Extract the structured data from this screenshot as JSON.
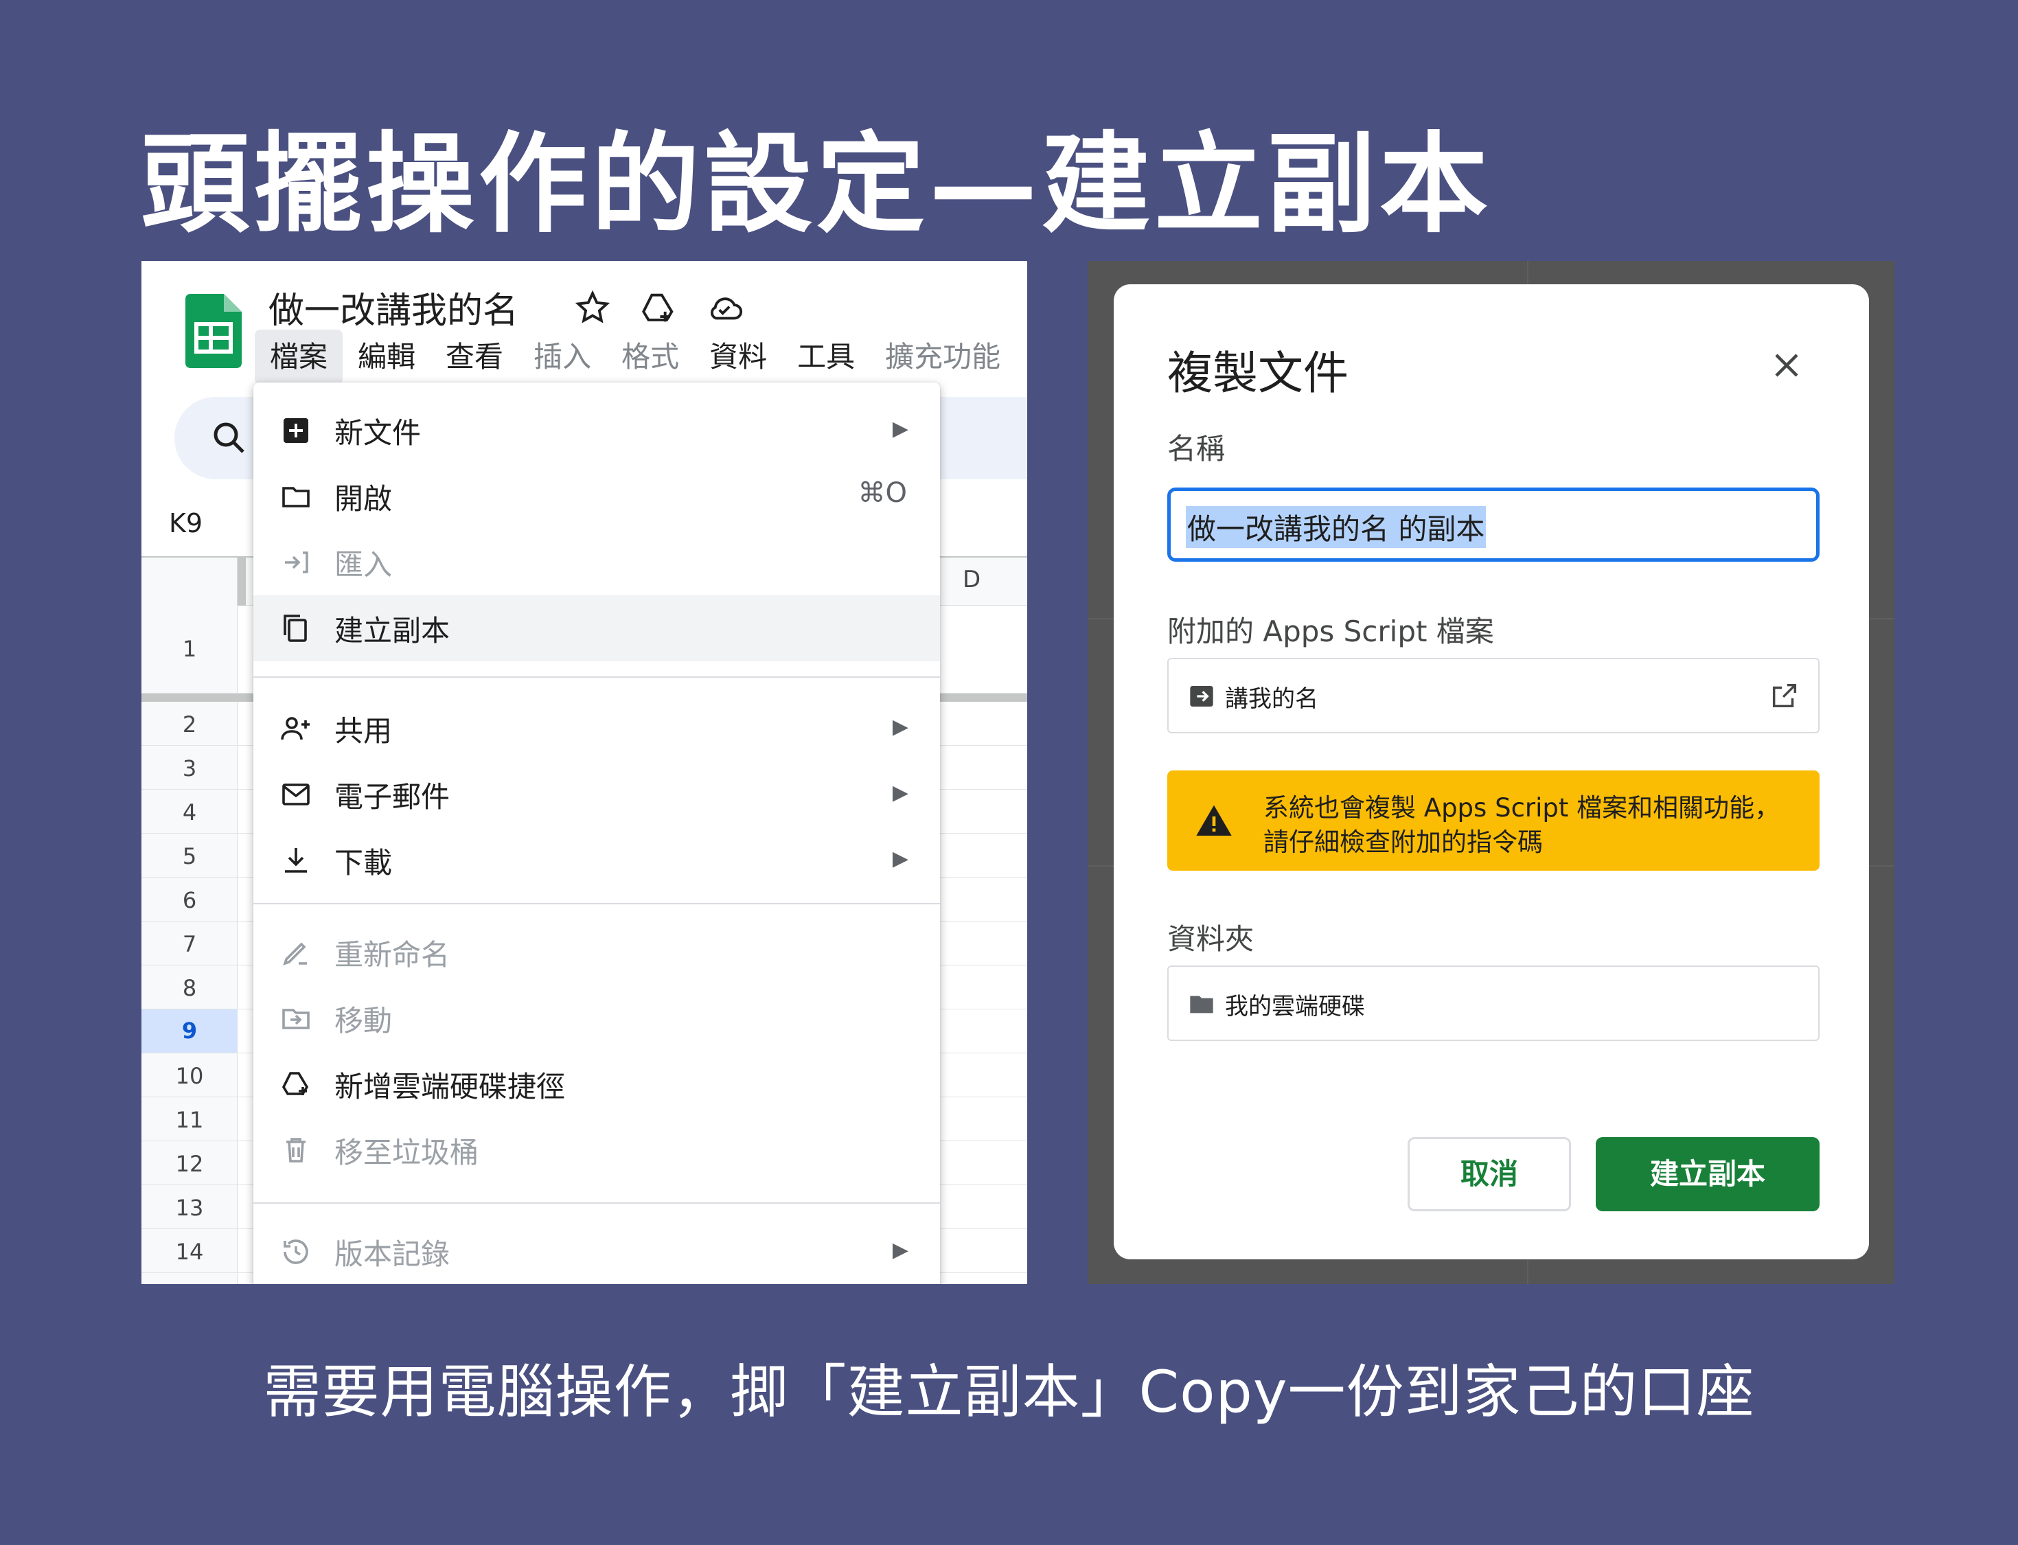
{
  "headline": "頭擺操作的設定—建立副本",
  "footer": "需要用電腦操作，揤「建立副本」Copy一份到家己的口座",
  "sheets": {
    "doc_title": "做一改講我的名",
    "menubar": [
      "檔案",
      "編輯",
      "查看",
      "插入",
      "格式",
      "資料",
      "工具",
      "擴充功能"
    ],
    "cell_ref": "K9",
    "column_d": "D",
    "rows": [
      "1",
      "2",
      "3",
      "4",
      "5",
      "6",
      "7",
      "8",
      "9",
      "10",
      "11",
      "12",
      "13",
      "14"
    ],
    "file_menu": {
      "new": "新文件",
      "open": "開啟",
      "open_shortcut": "⌘O",
      "import": "匯入",
      "make_copy": "建立副本",
      "share": "共用",
      "email": "電子郵件",
      "download": "下載",
      "rename": "重新命名",
      "move": "移動",
      "add_shortcut": "新增雲端硬碟捷徑",
      "trash": "移至垃圾桶",
      "version_history": "版本記錄"
    }
  },
  "dialog": {
    "title": "複製文件",
    "name_label": "名稱",
    "name_value": "做一改講我的名 的副本",
    "script_label": "附加的 Apps Script 檔案",
    "script_file": "講我的名",
    "warning_line1": "系統也會複製 Apps Script 檔案和相關功能，",
    "warning_line2": "請仔細檢查附加的指令碼",
    "folder_label": "資料夾",
    "folder_value": "我的雲端硬碟",
    "cancel": "取消",
    "create": "建立副本"
  },
  "colors": {
    "page_bg": "#4a5080",
    "sheets_green": "#188038",
    "warning_yellow": "#fbbc04",
    "focus_blue": "#1a73e8"
  }
}
